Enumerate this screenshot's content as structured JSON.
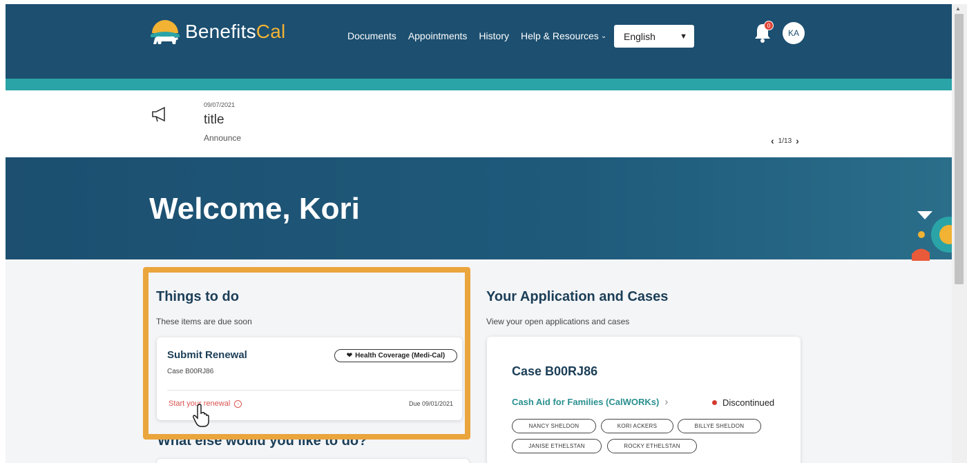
{
  "header": {
    "logo_text_a": "Benefits",
    "logo_text_b": "Cal",
    "nav": [
      "Documents",
      "Appointments",
      "History",
      "Help & Resources"
    ],
    "language": "English",
    "notification_count": "0",
    "avatar_initials": "KA"
  },
  "announcement": {
    "date": "09/07/2021",
    "title": "title",
    "subtitle": "Announce",
    "pager": "1/13"
  },
  "welcome": {
    "title": "Welcome, Kori"
  },
  "todo": {
    "title": "Things to do",
    "subtitle": "These items are due soon",
    "card": {
      "title": "Submit Renewal",
      "case": "Case B00RJ86",
      "program_pill": "Health Coverage (Medi-Cal)",
      "action": "Start your renewal",
      "due": "Due 09/01/2021"
    }
  },
  "more": {
    "title": "What else would you like to do?"
  },
  "cases": {
    "title": "Your Application and Cases",
    "subtitle": "View your open applications and cases",
    "card": {
      "title": "Case B00RJ86",
      "program": "Cash Aid for Families (CalWORKs)",
      "status": "Discontinued",
      "people": [
        "NANCY SHELDON",
        "KORI ACKERS",
        "BILLYE SHELDON",
        "JANISE ETHELSTAN",
        "ROCKY ETHELSTAN"
      ]
    }
  },
  "colors": {
    "header": "#1c4f70",
    "teal": "#2aa4a7",
    "highlight": "#eaa53c",
    "accent_gold": "#f2b233",
    "status_red": "#d33a2f"
  }
}
